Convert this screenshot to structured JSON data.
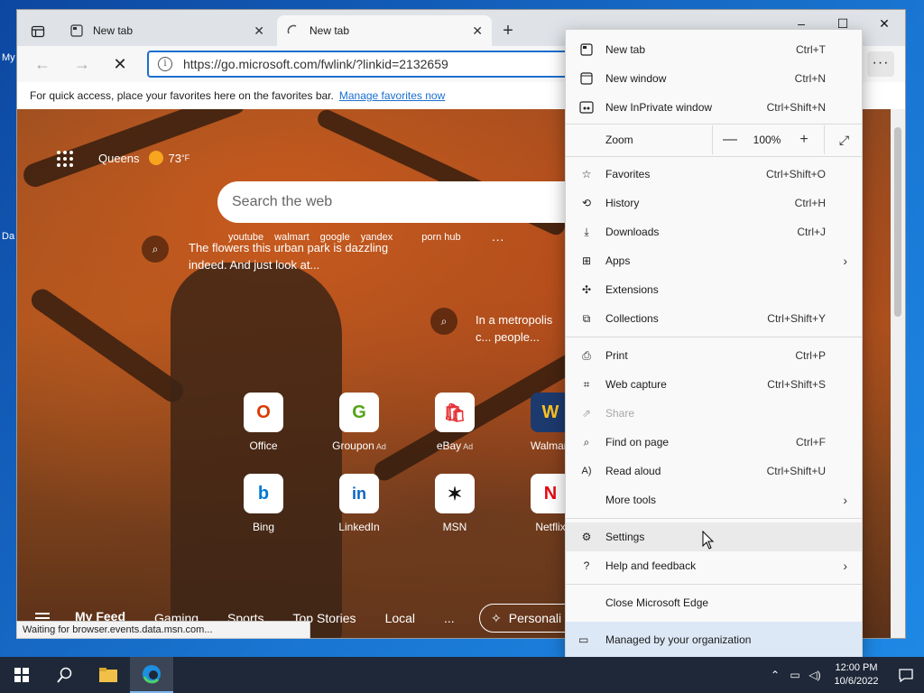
{
  "desktop": {
    "icon_labels": [
      "My",
      "Da"
    ]
  },
  "browser": {
    "tabs": [
      {
        "title": "New tab",
        "active": false
      },
      {
        "title": "New tab",
        "active": true,
        "loading": true
      }
    ],
    "window_controls": {
      "minimize": "–",
      "maximize": "☐",
      "close": "✕"
    },
    "address": {
      "url": "https://go.microsoft.com/fwlink/?linkid=2132659"
    },
    "favorites_bar": {
      "text": "For quick access, place your favorites here on the favorites bar.",
      "link": "Manage favorites now"
    },
    "status_text": "Waiting for browser.events.data.msn.com..."
  },
  "new_tab_page": {
    "weather": {
      "city": "Queens",
      "temp": "73",
      "unit": "°F"
    },
    "search_placeholder": "Search the web",
    "quick_links": [
      "youtube",
      "walmart",
      "google",
      "yandex",
      "porn hub"
    ],
    "stories": [
      {
        "text": "The flowers this urban park is dazzling indeed. And just look at..."
      },
      {
        "text": "In a metropolis c... people..."
      }
    ],
    "tiles": [
      {
        "label": "Office",
        "ad": "",
        "glyph": "O",
        "color": "#d83b01"
      },
      {
        "label": "Groupon",
        "ad": "Ad",
        "glyph": "G",
        "color": "#53a318"
      },
      {
        "label": "eBay",
        "ad": "Ad",
        "glyph": "🛍",
        "color": "#e53238"
      },
      {
        "label": "Walmart",
        "ad": "",
        "glyph": "W",
        "color": "#0071ce"
      },
      {
        "label": "Bing",
        "ad": "",
        "glyph": "b",
        "color": "#0078d4"
      },
      {
        "label": "LinkedIn",
        "ad": "",
        "glyph": "in",
        "color": "#0a66c2"
      },
      {
        "label": "MSN",
        "ad": "",
        "glyph": "✶",
        "color": "#111111"
      },
      {
        "label": "Netflix",
        "ad": "",
        "glyph": "N",
        "color": "#e50914"
      }
    ],
    "feed_tabs": [
      "My Feed",
      "Gaming",
      "Sports",
      "Top Stories",
      "Local",
      "..."
    ],
    "personalize_label": "Personali"
  },
  "menu": {
    "items": [
      {
        "label": "New tab",
        "shortcut": "Ctrl+T",
        "icon": "new-tab-icon"
      },
      {
        "label": "New window",
        "shortcut": "Ctrl+N",
        "icon": "new-window-icon"
      },
      {
        "label": "New InPrivate window",
        "shortcut": "Ctrl+Shift+N",
        "icon": "inprivate-icon"
      },
      {
        "label": "Favorites",
        "shortcut": "Ctrl+Shift+O",
        "icon": "star-icon"
      },
      {
        "label": "History",
        "shortcut": "Ctrl+H",
        "icon": "history-icon"
      },
      {
        "label": "Downloads",
        "shortcut": "Ctrl+J",
        "icon": "download-icon"
      },
      {
        "label": "Apps",
        "shortcut": "",
        "icon": "apps-icon",
        "submenu": true
      },
      {
        "label": "Extensions",
        "shortcut": "",
        "icon": "puzzle-icon"
      },
      {
        "label": "Collections",
        "shortcut": "Ctrl+Shift+Y",
        "icon": "collections-icon"
      },
      {
        "label": "Print",
        "shortcut": "Ctrl+P",
        "icon": "print-icon"
      },
      {
        "label": "Web capture",
        "shortcut": "Ctrl+Shift+S",
        "icon": "web-capture-icon"
      },
      {
        "label": "Share",
        "shortcut": "",
        "icon": "share-icon",
        "disabled": true
      },
      {
        "label": "Find on page",
        "shortcut": "Ctrl+F",
        "icon": "find-icon"
      },
      {
        "label": "Read aloud",
        "shortcut": "Ctrl+Shift+U",
        "icon": "read-aloud-icon"
      },
      {
        "label": "More tools",
        "shortcut": "",
        "icon": "",
        "submenu": true
      },
      {
        "label": "Settings",
        "shortcut": "",
        "icon": "gear-icon",
        "hover": true
      },
      {
        "label": "Help and feedback",
        "shortcut": "",
        "icon": "help-icon",
        "submenu": true
      },
      {
        "label": "Close Microsoft Edge",
        "shortcut": "",
        "icon": ""
      }
    ],
    "zoom": {
      "label": "Zoom",
      "value": "100%",
      "minus": "—",
      "plus": "+",
      "fullscreen": "⤢"
    },
    "managed_label": "Managed by your organization"
  },
  "taskbar": {
    "time": "12:00 PM",
    "date": "10/6/2022"
  }
}
